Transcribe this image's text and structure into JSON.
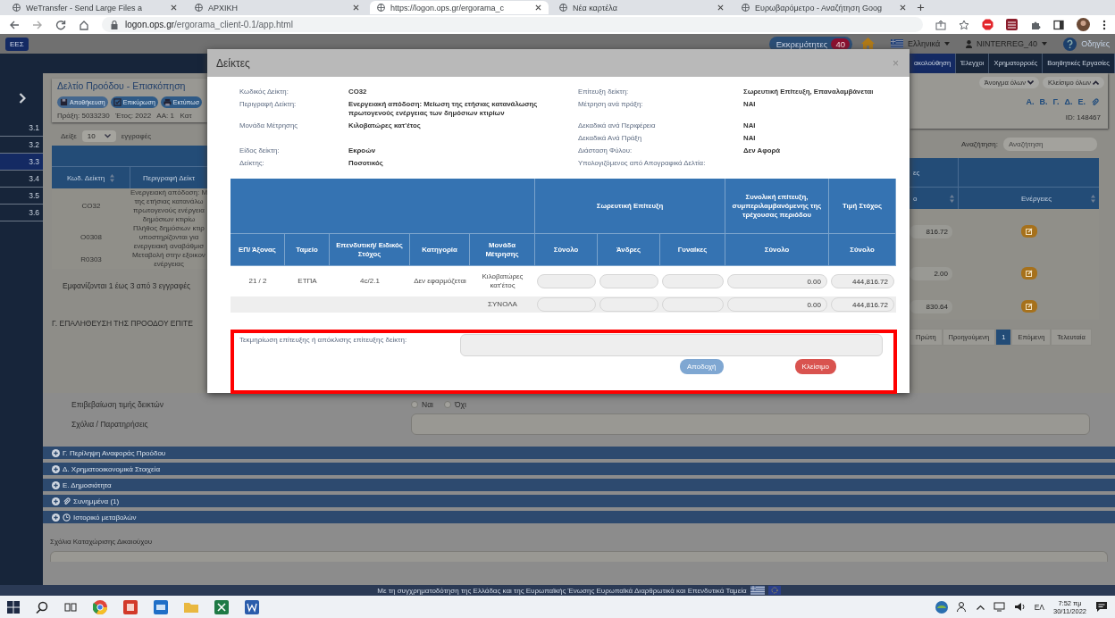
{
  "browser": {
    "tabs": [
      {
        "title": "WeTransfer - Send Large Files a",
        "selected": false
      },
      {
        "title": "ΑΡΧΙΚΗ",
        "selected": false
      },
      {
        "title": "https://logon.ops.gr/ergorama_c",
        "selected": true
      },
      {
        "title": "Νέα καρτέλα",
        "selected": false
      },
      {
        "title": "Ευρωβαρόμετρο - Αναζήτηση Goog",
        "selected": false
      }
    ],
    "url_host": "logon.ops.gr",
    "url_path": "/ergorama_client-0.1/app.html"
  },
  "app_header": {
    "logo": "ΕΕΣ",
    "pending_label": "Εκκρεμότητες",
    "pending_count": "40",
    "language": "Ελληνικά",
    "user": "NINTERREG_40",
    "help": "Οδηγίες"
  },
  "sidebar": {
    "items": [
      {
        "label": "3.1",
        "selected": false
      },
      {
        "label": "3.2",
        "selected": false
      },
      {
        "label": "3.3",
        "selected": true
      },
      {
        "label": "3.4",
        "selected": false
      },
      {
        "label": "3.5",
        "selected": false
      },
      {
        "label": "3.6",
        "selected": false
      }
    ]
  },
  "page": {
    "title": "Δελτίο Προόδου - Επισκόπηση",
    "actions": [
      {
        "label": "Αποθήκευση",
        "kind": "save"
      },
      {
        "label": "Επικύρωση",
        "kind": "validate"
      },
      {
        "label": "Εκτύπωσ",
        "kind": "print"
      }
    ],
    "meta": "Πράξη: 5033230   Έτος: 2022   ΑΑ: 1   Κατ",
    "nav_tabs": [
      {
        "label": "ακολούθηση",
        "selected": true
      },
      {
        "label": "Έλεγχοι",
        "selected": false
      },
      {
        "label": "Χρηματορροές",
        "selected": false
      },
      {
        "label": "Βοηθητικές Εργασίες",
        "selected": false
      }
    ],
    "expand_all": "Άνοιγμα όλων",
    "collapse_all": "Κλείσιμο όλων",
    "section_links": [
      "Α.",
      "Β.",
      "Γ.",
      "Δ.",
      "Ε."
    ],
    "record_id": "ID: 148467",
    "page_length": {
      "prefix": "Δείξε",
      "value": "10",
      "suffix": "εγγραφές"
    },
    "search": {
      "label": "Αναζήτηση:",
      "placeholder": "Αναζήτηση"
    },
    "table_left": {
      "columns": [
        "Κωδ. Δείκτη",
        "Περιγραφή Δείκτ"
      ],
      "rows": [
        {
          "code": "CO32",
          "description_lines": [
            "Ενεργειακή απόδοση: Μ",
            "της ετήσιας κατανάλω",
            "πρωτογενούς ενέργεια",
            "δημόσιων κτιρίω"
          ]
        },
        {
          "code": "O0308",
          "description_lines": [
            "Πλήθος δημόσιων κτιρ",
            "υποστηρίζονται για",
            "ενεργειακή αναβάθμισ"
          ]
        },
        {
          "code": "R0303",
          "description_lines": [
            "Μεταβολή στην εξοικον",
            "ενέργειας"
          ]
        }
      ]
    },
    "table_right": {
      "group_header": "ες",
      "columns": [
        "ο",
        "Ενέργειες"
      ],
      "rows": [
        {
          "value": "816.72"
        },
        {
          "value": "2.00"
        },
        {
          "value": "830.64"
        }
      ]
    },
    "table_info": "Εμφανίζονται 1 έως 3 από 3 εγγραφές",
    "pagination": [
      {
        "label": "Πρώτη",
        "selected": false
      },
      {
        "label": "Προηγούμενη",
        "selected": false
      },
      {
        "label": "1",
        "selected": true
      },
      {
        "label": "Επόμενη",
        "selected": false
      },
      {
        "label": "Τελευταία",
        "selected": false
      }
    ],
    "section_heading": "Γ. ΕΠΑΛΗΘΕΥΣΗ ΤΗΣ ΠΡΟΟΔΟΥ ΕΠΙΤΕ",
    "verification": {
      "label": "Επιβεβαίωση τιμής δεικτών",
      "options": [
        {
          "label": "Ναι",
          "selected": false
        },
        {
          "label": "Όχι",
          "selected": false
        }
      ],
      "comments_label": "Σχόλια / Παρατηρήσεις"
    },
    "accordions": [
      {
        "title": "Γ. Περίληψη Αναφοράς Προόδου",
        "kind": "plain"
      },
      {
        "title": "Δ. Χρηματοοικονομικά Στοιχεία",
        "kind": "plain"
      },
      {
        "title": "Ε. Δημοσιότητα",
        "kind": "plain"
      },
      {
        "title": "Συνημμένα (1)",
        "kind": "attachments"
      },
      {
        "title": "Ιστορικό μεταβολών",
        "kind": "history"
      }
    ],
    "beneficiary_comments_label": "Σχόλια Καταχώρισης Δικαιούχου",
    "footer": "Με τη συγχρηματοδότηση της Ελλάδας και της Ευρωπαϊκής Ένωσης Ευρωπαϊκά Διαρθρωτικά και Επενδυτικά Ταμεία"
  },
  "modal": {
    "title": "Δείκτες",
    "close": "×",
    "info_rows": [
      {
        "label_1": "Κωδικός Δείκτη:",
        "value_1": "CO32",
        "label_2": "Επίτευξη δείκτη:",
        "value_2": "Σωρευτική Επίτευξη, Επαναλαμβάνεται"
      },
      {
        "label_1": "Περιγραφή Δείκτη:",
        "value_1": "Ενεργειακή απόδοση: Μείωση της ετήσιας κατανάλωσης πρωτογενούς ενέργειας των δημόσιων κτιρίων",
        "label_2": "Μέτρηση ανά πράξη:",
        "value_2": "ΝΑΙ"
      },
      {
        "label_1": "Μονάδα Μέτρησης",
        "value_1": "Κιλοβατώρες κατ'έτος",
        "label_2": "Δεκαδικά ανά Περιφέρεια",
        "value_2": "ΝΑΙ"
      },
      {
        "label_2": "Δεκαδικά Ανά Πράξη",
        "value_2": "ΝΑΙ"
      },
      {
        "label_1": "Είδος δείκτη:",
        "value_1": "Εκροών",
        "label_2": "Διάσταση Φύλου:",
        "value_2": "Δεν Αφορά"
      },
      {
        "label_1": "Δείκτης:",
        "value_1": "Ποσοτικός",
        "label_2": "Υπολογιζόμενος από Απογραφικά Δελτία:"
      }
    ],
    "table": {
      "base_columns": [
        "ΕΠ/ Άξονας",
        "Ταμείο",
        "Επενδυτική/ Ειδικός Στόχος",
        "Κατηγορία",
        "Μονάδα Μέτρησης"
      ],
      "header_groups": [
        {
          "label": "Σωρευτική Επίτευξη",
          "columns": [
            "Σύνολο",
            "Άνδρες",
            "Γυναίκες"
          ]
        },
        {
          "label": "Συνολική επίτευξη, συμπεριλαμβανόμενης της τρέχουσας περιόδου",
          "columns": [
            "Σύνολο"
          ]
        },
        {
          "label": "Τιμή Στόχος",
          "columns": [
            "Σύνολο"
          ]
        }
      ],
      "rows": [
        {
          "cells": [
            "21 / 2",
            "ΕΤΠΑ",
            "4c/2.1",
            "Δεν εφαρμόζεται",
            "Κιλοβατώρες κατ'έτος"
          ],
          "fields": [
            {
              "kind": "empty"
            },
            {
              "kind": "empty"
            },
            {
              "kind": "empty"
            },
            {
              "kind": "value",
              "value": "0.00"
            },
            {
              "kind": "value",
              "value": "444,816.72"
            }
          ]
        }
      ],
      "totals": {
        "label": "ΣΥΝΟΛΑ",
        "fields": [
          {
            "kind": "empty"
          },
          {
            "kind": "empty"
          },
          {
            "kind": "empty"
          },
          {
            "kind": "value",
            "value": "0.00"
          },
          {
            "kind": "value",
            "value": "444,816.72"
          }
        ]
      }
    },
    "evidence_label": "Τεκμηρίωση επίτευξης ή απόκλισης επίτευξης δείκτη:",
    "buttons": [
      {
        "label": "Αποδοχή",
        "kind": "primary"
      },
      {
        "label": "Κλείσιμο",
        "kind": "danger"
      }
    ],
    "highlighted": true
  },
  "taskbar": {
    "language": "ΕΛ",
    "time": "7:52 πμ",
    "date": "30/11/2022"
  }
}
